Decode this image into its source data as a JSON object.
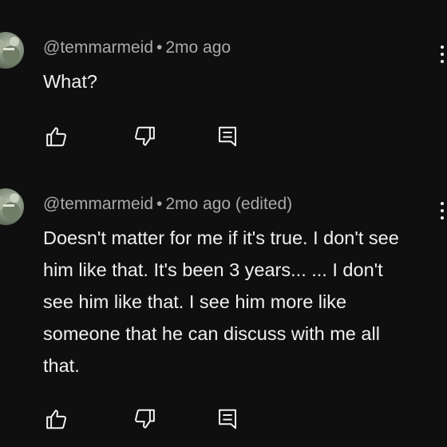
{
  "comments": [
    {
      "author": "@temmarmeid",
      "separator": "•",
      "time": "2mo ago",
      "text": "What?",
      "icons": {
        "like": "thumbs-up-icon",
        "dislike": "thumbs-down-icon",
        "reply": "reply-icon",
        "menu": "more-vert-icon"
      }
    },
    {
      "author": "@temmarmeid",
      "separator": "•",
      "time": "2mo ago (edited)",
      "text": "Doesn't matter for me if it's true. I don't see him like that. It's been 3 years... ... I don't see him like that. I see him more like someone that he can discuss with me all that.",
      "icons": {
        "like": "thumbs-up-icon",
        "dislike": "thumbs-down-icon",
        "reply": "reply-icon",
        "menu": "more-vert-icon"
      }
    }
  ],
  "colors": {
    "background": "#0f0f0f",
    "primary_text": "#f1f1f1",
    "secondary_text": "#aaaaaa"
  }
}
